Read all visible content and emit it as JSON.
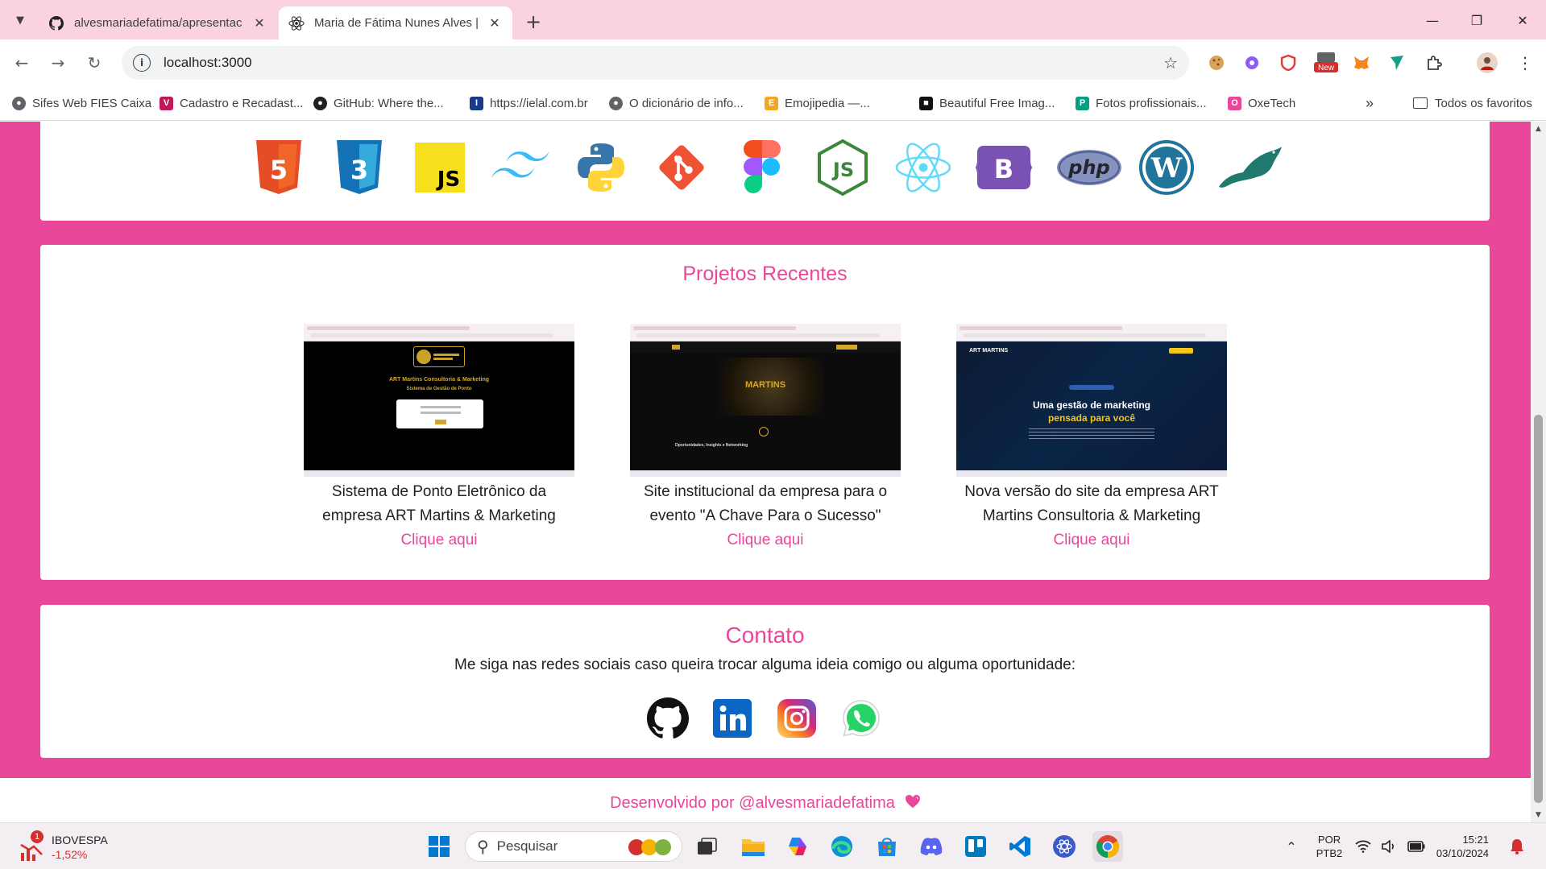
{
  "browser": {
    "tabs": [
      {
        "title": "alvesmariadefatima/apresentac",
        "active": false,
        "icon": "github-icon"
      },
      {
        "title": "Maria de Fátima Nunes Alves | D",
        "active": true,
        "icon": "react-icon"
      }
    ],
    "url": "localhost:3000",
    "extensions": [
      "cookie-icon",
      "gear-extension-icon",
      "shield-icon",
      "new-badge-extension-icon",
      "metamask-fox-icon",
      "kite-icon",
      "puzzle-icon",
      "profile-avatar"
    ],
    "new_badge": "New",
    "bookmarks": [
      {
        "label": "Sifes Web FIES Caixa",
        "icon": "globe-icon",
        "color": "#5f6368"
      },
      {
        "label": "Cadastro e Recadast...",
        "icon": "v-logo-icon",
        "color": "#c2185b"
      },
      {
        "label": "GitHub: Where the...",
        "icon": "github-icon",
        "color": "#202124"
      },
      {
        "label": "https://ielal.com.br",
        "icon": "ielal-icon",
        "color": "#1a3a8f"
      },
      {
        "label": "O dicionário de info...",
        "icon": "globe-icon",
        "color": "#5f6368"
      },
      {
        "label": "Emojipedia —...",
        "icon": "emojipedia-icon",
        "color": "#f4a623"
      },
      {
        "label": "Beautiful Free Imag...",
        "icon": "unsplash-icon",
        "color": "#111111"
      },
      {
        "label": "Fotos profissionais...",
        "icon": "pexels-icon",
        "color": "#05a081"
      },
      {
        "label": "OxeTech",
        "icon": "oxetech-icon",
        "color": "#e8479a"
      }
    ],
    "all_bookmarks": "Todos os favoritos"
  },
  "page": {
    "tech_icons": [
      "html5-icon",
      "css3-icon",
      "javascript-icon",
      "tailwind-icon",
      "python-icon",
      "git-icon",
      "figma-icon",
      "nodejs-icon",
      "react-icon",
      "bootstrap-icon",
      "php-icon",
      "wordpress-icon",
      "mariadb-icon"
    ],
    "projects_title": "Projetos Recentes",
    "projects": [
      {
        "desc_line1": "Sistema de Ponto Eletrônico da",
        "desc_line2": "empresa ART Martins & Marketing",
        "link": "Clique aqui",
        "shot_heading": "ART Martins Consultoria & Marketing",
        "shot_sub": "Sistema de Gestão de Ponto"
      },
      {
        "desc_line1": "Site institucional da empresa para o",
        "desc_line2": "evento \"A Chave Para o Sucesso\"",
        "link": "Clique aqui",
        "shot_heading": "MARTINS",
        "shot_sub": "Oportunidades, Insights e Networking"
      },
      {
        "desc_line1": "Nova versão do site da empresa ART",
        "desc_line2": "Martins Consultoria & Marketing",
        "link": "Clique aqui",
        "shot_heading": "Uma gestão de marketing",
        "shot_sub": "pensada para você"
      }
    ],
    "contact_title": "Contato",
    "contact_text": "Me siga nas redes sociais caso queira trocar alguma ideia comigo ou alguma oportunidade:",
    "socials": [
      "github-icon",
      "linkedin-icon",
      "instagram-icon",
      "whatsapp-icon"
    ],
    "footer_text": "Desenvolvido por @alvesmariadefatima",
    "colors": {
      "accent": "#e8479a",
      "background": "#e8479a"
    }
  },
  "taskbar": {
    "stock_name": "IBOVESPA",
    "stock_change": "-1,52%",
    "stock_badge": "1",
    "search_placeholder": "Pesquisar",
    "lang_line1": "POR",
    "lang_line2": "PTB2",
    "time": "15:21",
    "date": "03/10/2024"
  }
}
